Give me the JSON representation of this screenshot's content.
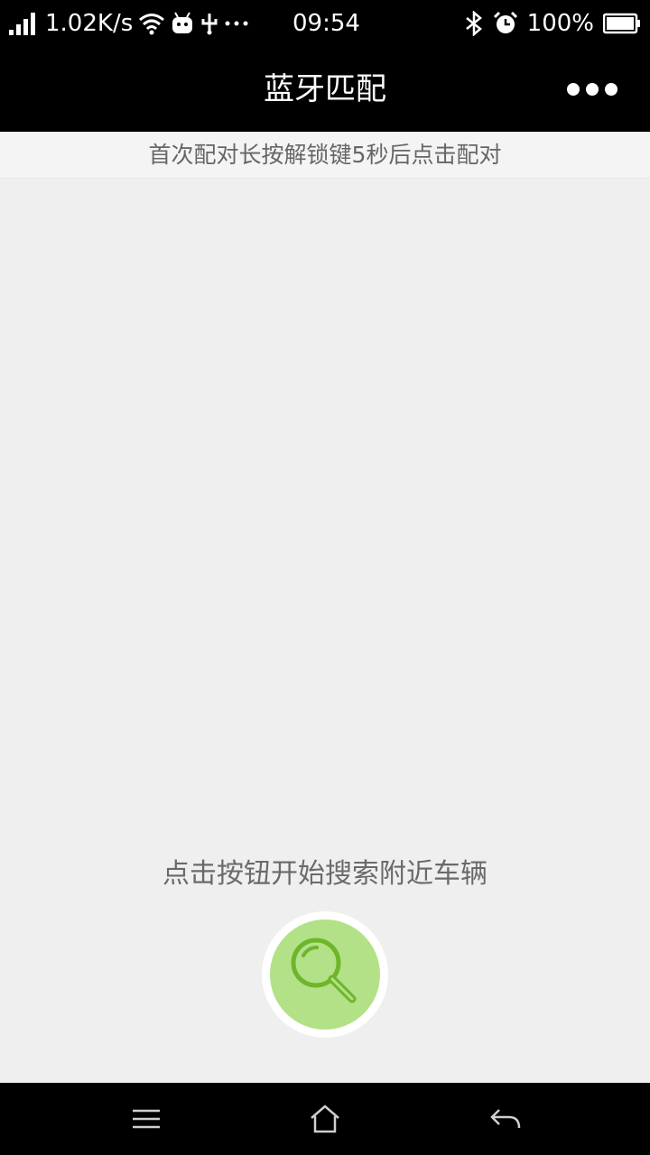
{
  "status_bar": {
    "speed": "1.02K/s",
    "time": "09:54",
    "battery": "100%",
    "icons": [
      "signal-icon",
      "wifi-icon",
      "android-icon",
      "usb-icon",
      "more-dots-icon",
      "bluetooth-icon",
      "alarm-icon",
      "battery-icon"
    ]
  },
  "header": {
    "title": "蓝牙匹配",
    "menu_icon": "more-icon"
  },
  "hint": {
    "text": "首次配对长按解锁键5秒后点击配对"
  },
  "main": {
    "prompt": "点击按钮开始搜索附近车辆",
    "search_icon": "search-icon",
    "colors": {
      "button_fill": "#b3e187",
      "icon_stroke": "#6fb52c"
    }
  },
  "nav_bar": {
    "icons": [
      "menu-icon",
      "home-icon",
      "back-icon"
    ]
  }
}
